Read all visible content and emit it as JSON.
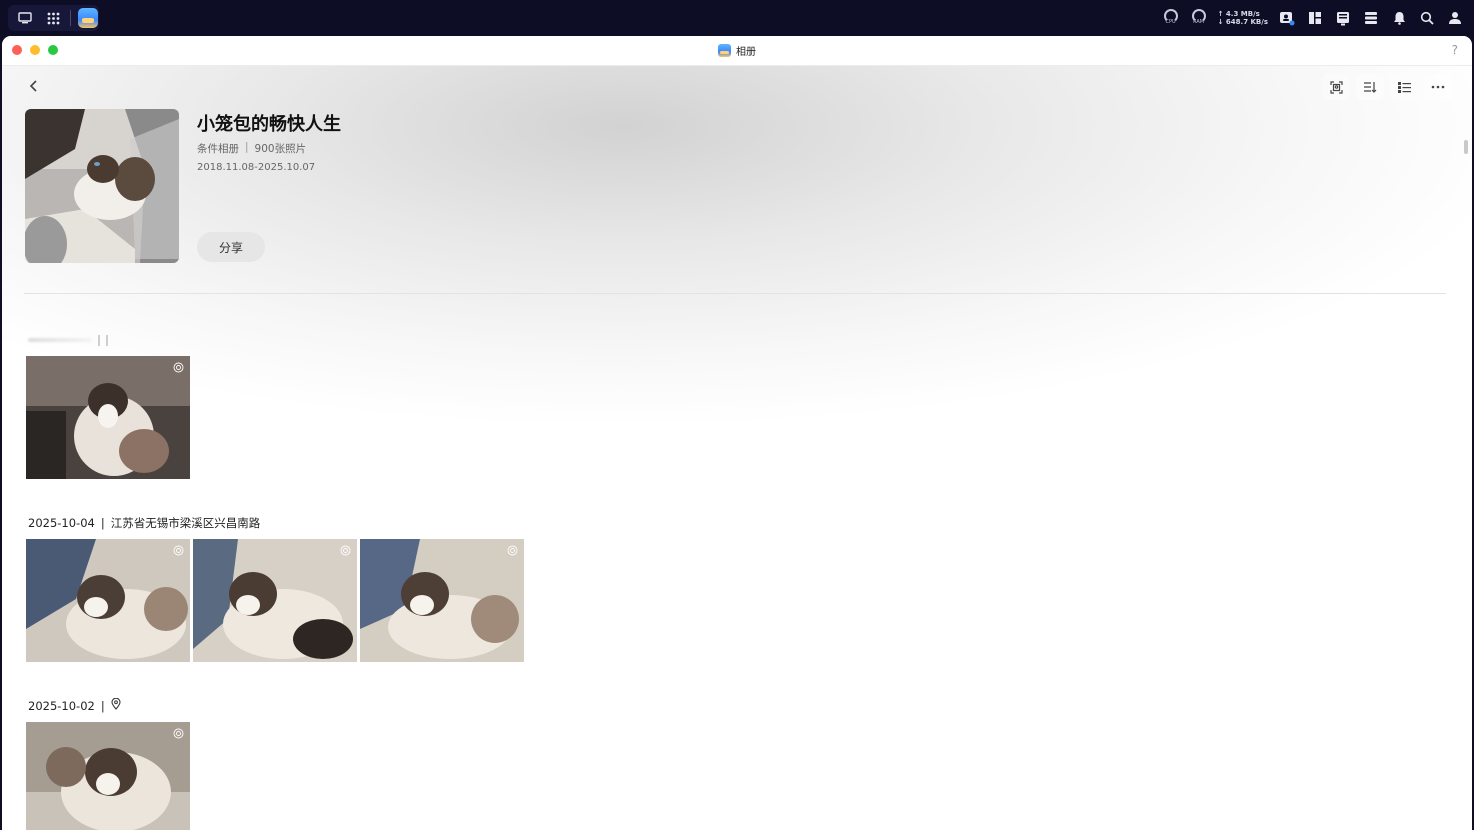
{
  "window": {
    "title": "相册",
    "help": "?"
  },
  "system": {
    "net_up": "↑ 4.3 MB/s",
    "net_down": "↓ 648.7 KB/s",
    "cpu_label": "CPU",
    "ram_label": "RAM"
  },
  "album": {
    "title": "小笼包的畅快人生",
    "type": "条件相册",
    "separator": "|",
    "count": "900张照片",
    "date_range": "2018.11.08-2025.10.07",
    "share_label": "分享"
  },
  "sections": [
    {
      "date": "2025-10-04",
      "separator": "|",
      "location": "江苏省无锡市梁溪区兴昌南路"
    },
    {
      "date": "2025-10-02",
      "separator": "|"
    }
  ],
  "colors": {
    "accent": "#3a86ff",
    "divider": "#e3e3e3"
  }
}
